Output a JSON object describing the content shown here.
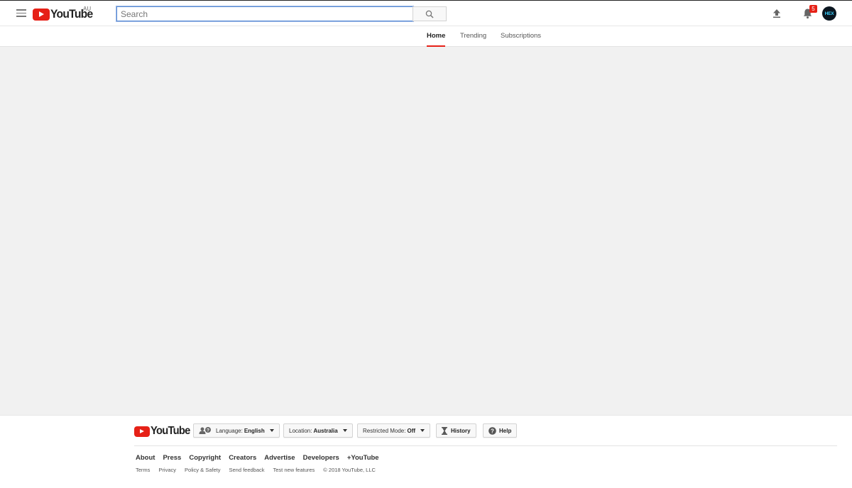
{
  "header": {
    "logo_text": "YouTube",
    "country": "AU",
    "search": {
      "placeholder": "Search",
      "value": ""
    },
    "notification_count": "5",
    "avatar_text": "HEX"
  },
  "nav": {
    "tabs": [
      {
        "label": "Home",
        "active": true
      },
      {
        "label": "Trending",
        "active": false
      },
      {
        "label": "Subscriptions",
        "active": false
      }
    ]
  },
  "footer": {
    "logo_text": "YouTube",
    "language": {
      "label": "Language:",
      "value": "English"
    },
    "location": {
      "label": "Location:",
      "value": "Australia"
    },
    "restricted": {
      "label": "Restricted Mode:",
      "value": "Off"
    },
    "history_label": "History",
    "help_label": "Help",
    "links": [
      "About",
      "Press",
      "Copyright",
      "Creators",
      "Advertise",
      "Developers",
      "+YouTube"
    ],
    "sublinks": [
      "Terms",
      "Privacy",
      "Policy & Safety",
      "Send feedback",
      "Test new features"
    ],
    "copyright": "© 2018 YouTube, LLC"
  },
  "colors": {
    "brand_red": "#e62117",
    "main_bg": "#f1f1f1",
    "search_focus": "#5b8dd6"
  },
  "icons": [
    "menu-icon",
    "search-icon",
    "upload-icon",
    "bell-icon",
    "language-icon",
    "history-icon",
    "help-icon"
  ]
}
